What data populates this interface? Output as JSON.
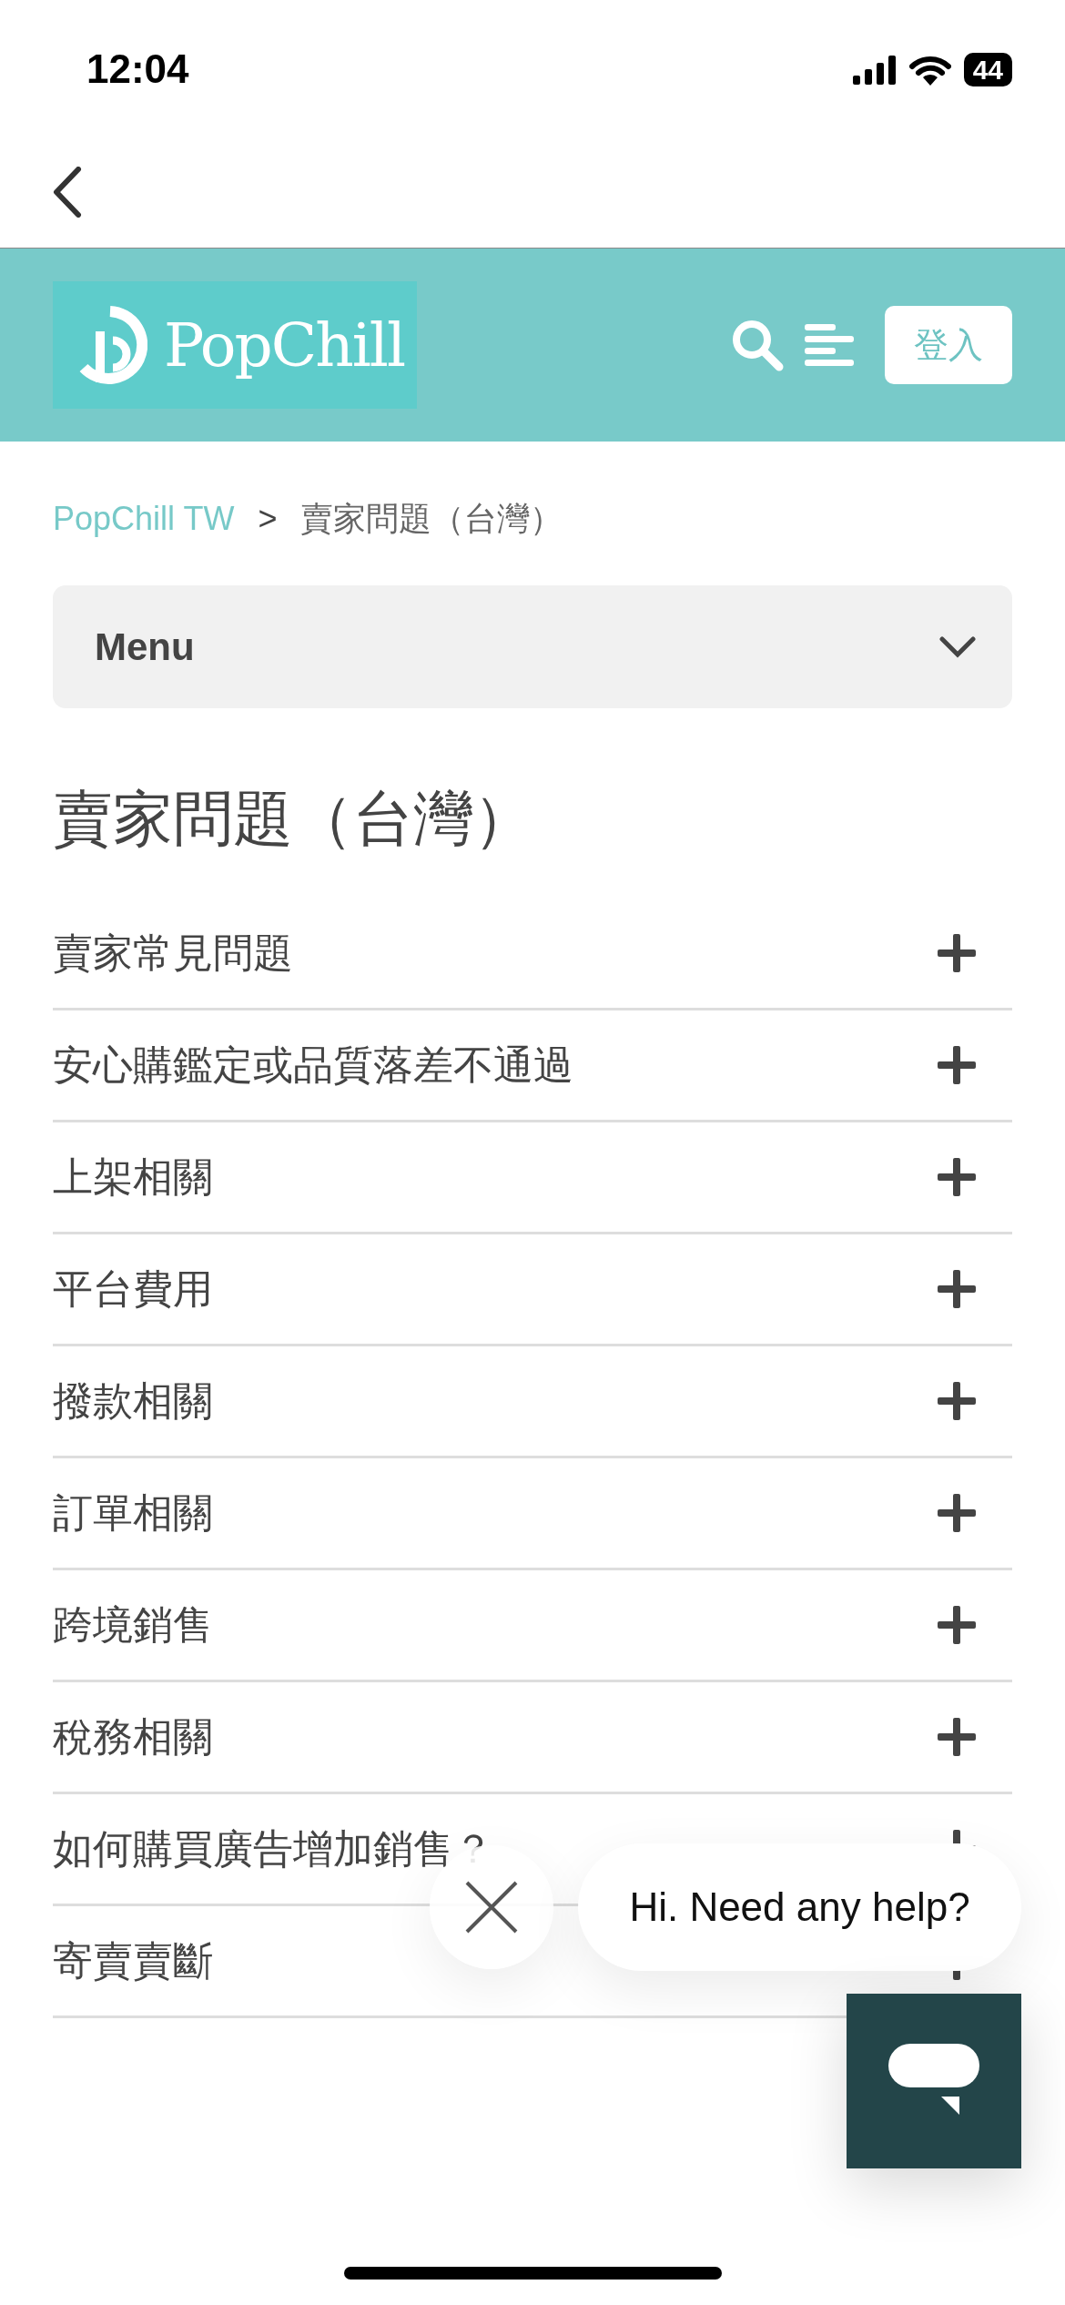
{
  "status_bar": {
    "time": "12:04",
    "battery": "44"
  },
  "header": {
    "logo_text": "PopChill",
    "login_button": "登入"
  },
  "breadcrumb": [
    {
      "label": "PopChill TW",
      "kind": "link"
    },
    {
      "label": ">",
      "kind": "separator"
    },
    {
      "label": "賣家問題（台灣）",
      "kind": "current"
    }
  ],
  "menu_dropdown": {
    "label": "Menu",
    "expanded": false
  },
  "title": "賣家問題（台灣）",
  "faq_sections": [
    {
      "label": "賣家常見問題",
      "expanded": false
    },
    {
      "label": "安心購鑑定或品質落差不通過",
      "expanded": false
    },
    {
      "label": "上架相關",
      "expanded": false
    },
    {
      "label": "平台費用",
      "expanded": false
    },
    {
      "label": "撥款相關",
      "expanded": false
    },
    {
      "label": "訂單相關",
      "expanded": false
    },
    {
      "label": "跨境銷售",
      "expanded": false
    },
    {
      "label": "稅務相關",
      "expanded": false
    },
    {
      "label": "如何購買廣告增加銷售？",
      "expanded": false
    },
    {
      "label": "寄賣賣斷",
      "expanded": false
    }
  ],
  "chat_widget": {
    "greeting": "Hi. Need any help?"
  }
}
